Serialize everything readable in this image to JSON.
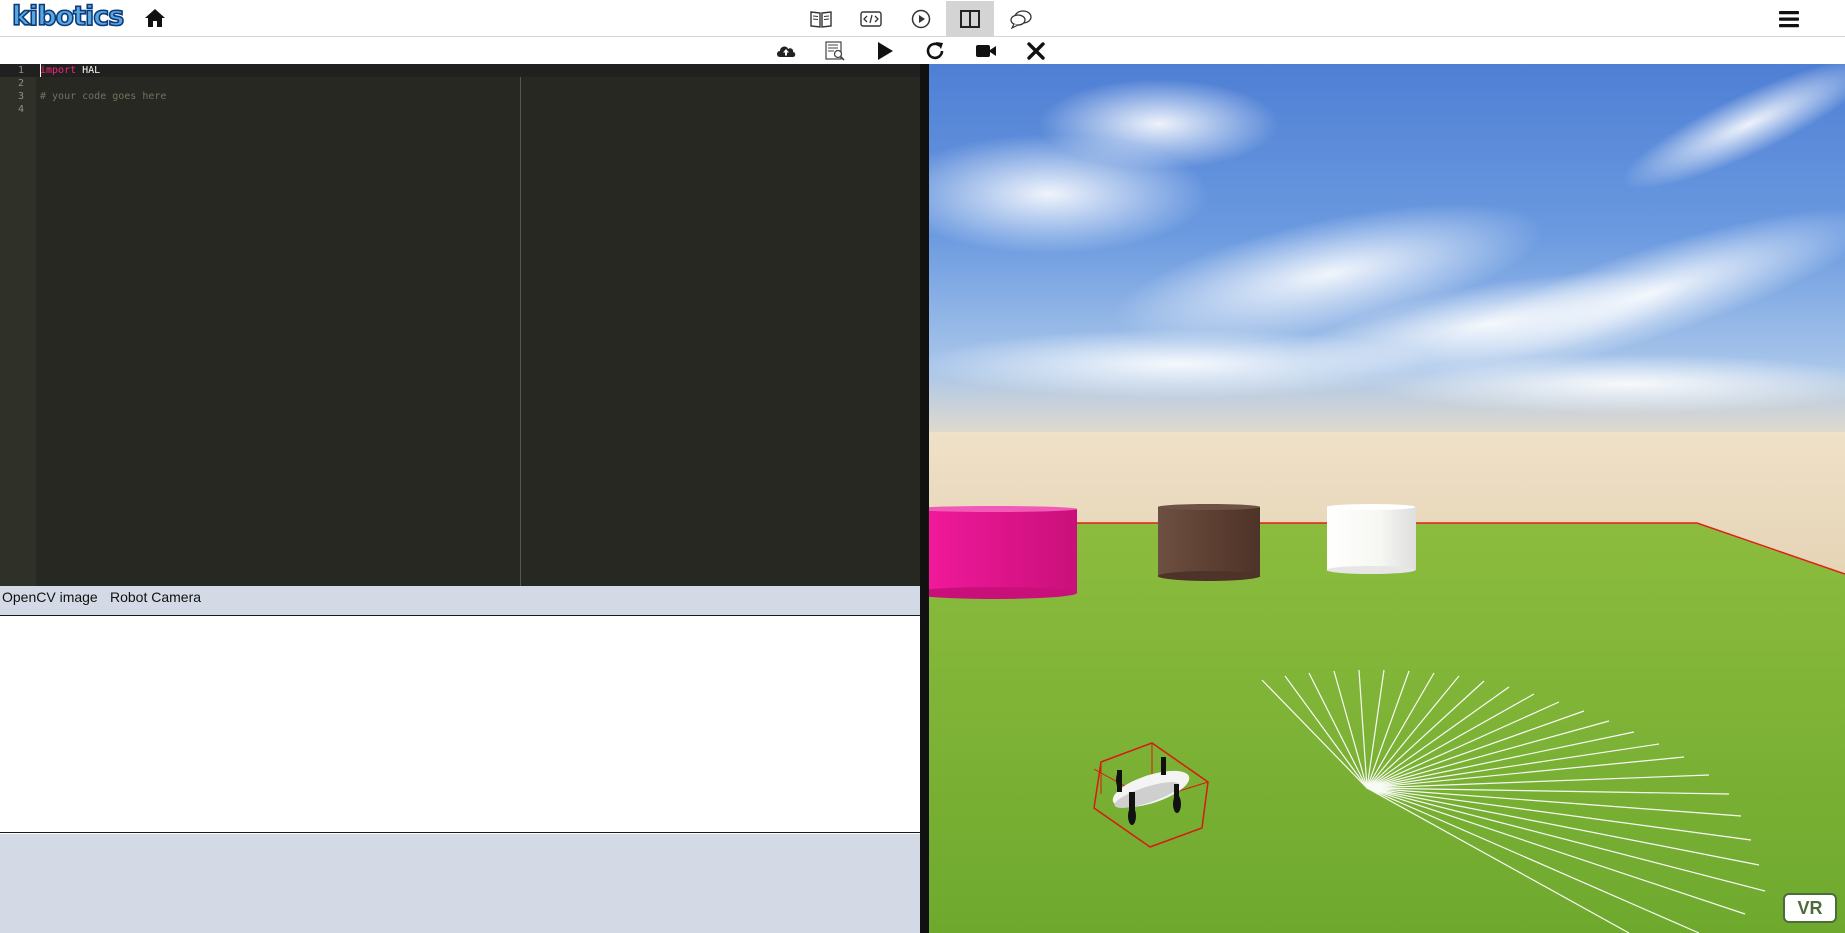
{
  "header": {
    "logo_text": "kibotics",
    "icons": {
      "home": "home-icon",
      "menu": "hamburger-menu-icon"
    },
    "view_modes": [
      {
        "name": "documentation",
        "icon": "book-icon"
      },
      {
        "name": "code-only",
        "icon": "code-icon"
      },
      {
        "name": "simulation-only",
        "icon": "play-circle-icon"
      },
      {
        "name": "split-view",
        "icon": "split-panel-icon",
        "active": true
      },
      {
        "name": "chat",
        "icon": "chat-bubbles-icon"
      }
    ]
  },
  "toolbar": {
    "items": [
      {
        "name": "upload",
        "icon": "cloud-upload-icon"
      },
      {
        "name": "inspect",
        "icon": "document-search-icon"
      },
      {
        "name": "run",
        "icon": "play-icon"
      },
      {
        "name": "reset",
        "icon": "reload-icon"
      },
      {
        "name": "camera",
        "icon": "video-camera-icon"
      },
      {
        "name": "stop",
        "icon": "close-icon"
      }
    ]
  },
  "editor": {
    "lines": [
      {
        "number": "1",
        "keyword": "import",
        "text": " HAL"
      },
      {
        "number": "2",
        "keyword": "",
        "text": ""
      },
      {
        "number": "3",
        "comment": "# your code goes here"
      },
      {
        "number": "4",
        "keyword": "",
        "text": ""
      }
    ]
  },
  "panels": {
    "tabs": [
      "OpenCV image",
      "Robot Camera"
    ]
  },
  "viewport": {
    "vr_label": "VR"
  },
  "colors": {
    "editor_bg": "#272822",
    "keyword": "#f92672",
    "comment": "#75715e",
    "panel_bg": "#d3dae5",
    "grass": "#7fb33a",
    "sky": "#5a8ad6"
  }
}
